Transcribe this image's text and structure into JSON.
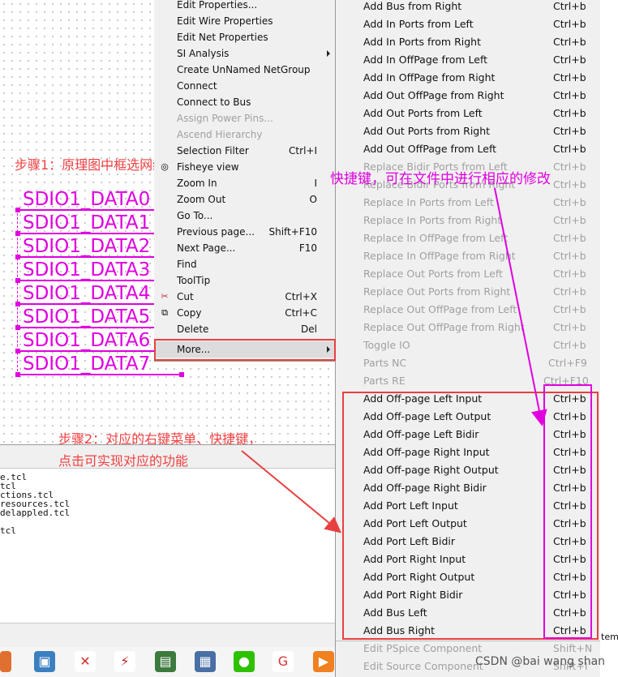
{
  "canvas": {
    "net_labels": [
      "SDIO1_DATA0",
      "SDIO1_DATA1",
      "SDIO1_DATA2",
      "SDIO1_DATA3",
      "SDIO1_DATA4",
      "SDIO1_DATA5",
      "SDIO1_DATA6",
      "SDIO1_DATA7"
    ]
  },
  "annotations": {
    "step1": "步骤1：原理图中框选网络",
    "step2_line1": "步骤2：对应的右键菜单、快捷键，",
    "step2_line2": "点击可实现对应的功能",
    "shortcut_note": "快捷键，可在文件中进行相应的修改"
  },
  "log_lines": [
    "e.tcl",
    "tcl",
    "ctions.tcl",
    "resources.tcl",
    "delappled.tcl",
    "",
    "tcl"
  ],
  "context_menu": {
    "items": [
      {
        "label": "Edit Properties...",
        "shortcut": "",
        "disabled": false
      },
      {
        "label": "Edit Wire Properties",
        "shortcut": "",
        "disabled": false
      },
      {
        "label": "Edit Net Properties",
        "shortcut": "",
        "disabled": false
      },
      {
        "label": "SI Analysis",
        "shortcut": "",
        "disabled": false,
        "submenu": true
      },
      {
        "label": "Create UnNamed NetGroup",
        "shortcut": "",
        "disabled": false
      },
      {
        "label": "Connect",
        "shortcut": "",
        "disabled": false
      },
      {
        "label": "Connect to Bus",
        "shortcut": "",
        "disabled": false
      },
      {
        "label": "Assign Power Pins...",
        "shortcut": "",
        "disabled": true
      },
      {
        "label": "Ascend Hierarchy",
        "shortcut": "",
        "disabled": true
      },
      {
        "label": "Selection Filter",
        "shortcut": "Ctrl+I",
        "disabled": false
      },
      {
        "label": "Fisheye view",
        "shortcut": "",
        "disabled": false
      },
      {
        "label": "Zoom In",
        "shortcut": "I",
        "disabled": false
      },
      {
        "label": "Zoom Out",
        "shortcut": "O",
        "disabled": false
      },
      {
        "label": "Go To...",
        "shortcut": "",
        "disabled": false
      },
      {
        "label": "Previous page...",
        "shortcut": "Shift+F10",
        "disabled": false
      },
      {
        "label": "Next Page...",
        "shortcut": "F10",
        "disabled": false
      },
      {
        "label": "Find",
        "shortcut": "",
        "disabled": false
      },
      {
        "label": "ToolTip",
        "shortcut": "",
        "disabled": false
      },
      {
        "label": "Cut",
        "shortcut": "Ctrl+X",
        "disabled": false,
        "icon": "scissors-icon"
      },
      {
        "label": "Copy",
        "shortcut": "Ctrl+C",
        "disabled": false,
        "icon": "copy-icon"
      },
      {
        "label": "Delete",
        "shortcut": "Del",
        "disabled": false
      },
      {
        "label": "More...",
        "shortcut": "",
        "disabled": false,
        "submenu": true
      }
    ]
  },
  "more_submenu": {
    "items": [
      {
        "label": "Add Bus from Right",
        "shortcut": "Ctrl+b",
        "disabled": false
      },
      {
        "label": "Add In Ports from Left",
        "shortcut": "Ctrl+b",
        "disabled": false
      },
      {
        "label": "Add In Ports from Right",
        "shortcut": "Ctrl+b",
        "disabled": false
      },
      {
        "label": "Add In OffPage from Left",
        "shortcut": "Ctrl+b",
        "disabled": false
      },
      {
        "label": "Add In OffPage from Right",
        "shortcut": "Ctrl+b",
        "disabled": false
      },
      {
        "label": "Add Out OffPage from Right",
        "shortcut": "Ctrl+b",
        "disabled": false
      },
      {
        "label": "Add Out Ports from Left",
        "shortcut": "Ctrl+b",
        "disabled": false
      },
      {
        "label": "Add Out Ports from Right",
        "shortcut": "Ctrl+b",
        "disabled": false
      },
      {
        "label": "Add Out OffPage from Left",
        "shortcut": "Ctrl+b",
        "disabled": false
      },
      {
        "label": "Replace Bidir Ports from Left",
        "shortcut": "Ctrl+b",
        "disabled": true
      },
      {
        "label": "Replace Bidir Ports from Right",
        "shortcut": "Ctrl+b",
        "disabled": true
      },
      {
        "label": "Replace In Ports from Left",
        "shortcut": "Ctrl+b",
        "disabled": true
      },
      {
        "label": "Replace In Ports from Right",
        "shortcut": "Ctrl+b",
        "disabled": true
      },
      {
        "label": "Replace In OffPage from Left",
        "shortcut": "Ctrl+b",
        "disabled": true
      },
      {
        "label": "Replace In OffPage from Right",
        "shortcut": "Ctrl+b",
        "disabled": true
      },
      {
        "label": "Replace Out Ports from Left",
        "shortcut": "Ctrl+b",
        "disabled": true
      },
      {
        "label": "Replace Out Ports from Right",
        "shortcut": "Ctrl+b",
        "disabled": true
      },
      {
        "label": "Replace Out OffPage from Left",
        "shortcut": "Ctrl+b",
        "disabled": true
      },
      {
        "label": "Replace Out OffPage from Right",
        "shortcut": "Ctrl+b",
        "disabled": true
      },
      {
        "label": "Toggle IO",
        "shortcut": "Ctrl+b",
        "disabled": true
      },
      {
        "label": "Parts NC",
        "shortcut": "Ctrl+F9",
        "disabled": true
      },
      {
        "label": "Parts RE",
        "shortcut": "Ctrl+F10",
        "disabled": true
      },
      {
        "label": "Add Off-page Left Input",
        "shortcut": "Ctrl+b",
        "disabled": false
      },
      {
        "label": "Add Off-page Left Output",
        "shortcut": "Ctrl+b",
        "disabled": false
      },
      {
        "label": "Add Off-page Left Bidir",
        "shortcut": "Ctrl+b",
        "disabled": false
      },
      {
        "label": "Add Off-page Right Input",
        "shortcut": "Ctrl+b",
        "disabled": false
      },
      {
        "label": "Add Off-page Right Output",
        "shortcut": "Ctrl+b",
        "disabled": false
      },
      {
        "label": "Add Off-page Right Bidir",
        "shortcut": "Ctrl+b",
        "disabled": false
      },
      {
        "label": "Add Port Left Input",
        "shortcut": "Ctrl+b",
        "disabled": false
      },
      {
        "label": "Add Port Left Output",
        "shortcut": "Ctrl+b",
        "disabled": false
      },
      {
        "label": "Add Port Left Bidir",
        "shortcut": "Ctrl+b",
        "disabled": false
      },
      {
        "label": "Add Port Right Input",
        "shortcut": "Ctrl+b",
        "disabled": false
      },
      {
        "label": "Add Port Right Output",
        "shortcut": "Ctrl+b",
        "disabled": false
      },
      {
        "label": "Add Port Right Bidir",
        "shortcut": "Ctrl+b",
        "disabled": false
      },
      {
        "label": "Add Bus Left",
        "shortcut": "Ctrl+b",
        "disabled": false
      },
      {
        "label": "Add Bus Right",
        "shortcut": "Ctrl+b",
        "disabled": false
      },
      {
        "label": "Edit PSpice Component",
        "shortcut": "Shift+N",
        "disabled": true
      },
      {
        "label": "Edit Source Component",
        "shortcut": "Shift+I",
        "disabled": true
      }
    ]
  },
  "edge_text": "tem",
  "watermark": "CSDN @bai wang shan",
  "colors": {
    "highlight_red": "#e84040",
    "highlight_magenta": "#e000e0",
    "net_color": "#e000e0"
  }
}
